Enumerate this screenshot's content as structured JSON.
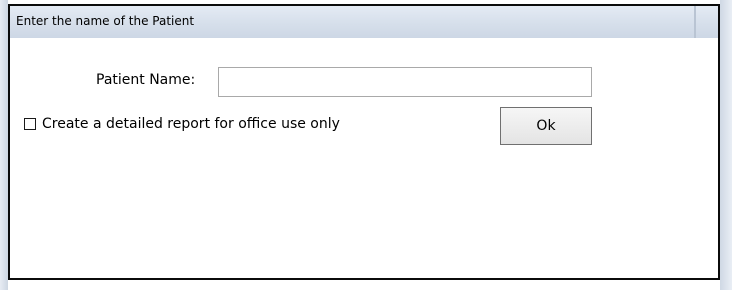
{
  "dialog": {
    "title": "Enter the name of the Patient"
  },
  "form": {
    "patient_name_label": "Patient Name:",
    "patient_name_value": "",
    "patient_name_placeholder": "",
    "report_checkbox_label": "Create a detailed report for office use only",
    "report_checkbox_checked": false,
    "ok_label": "Ok"
  },
  "colors": {
    "titlebar": "#d6dfeb",
    "dialog_border": "#0b0b0b",
    "button_face": "#e9e9e9"
  }
}
